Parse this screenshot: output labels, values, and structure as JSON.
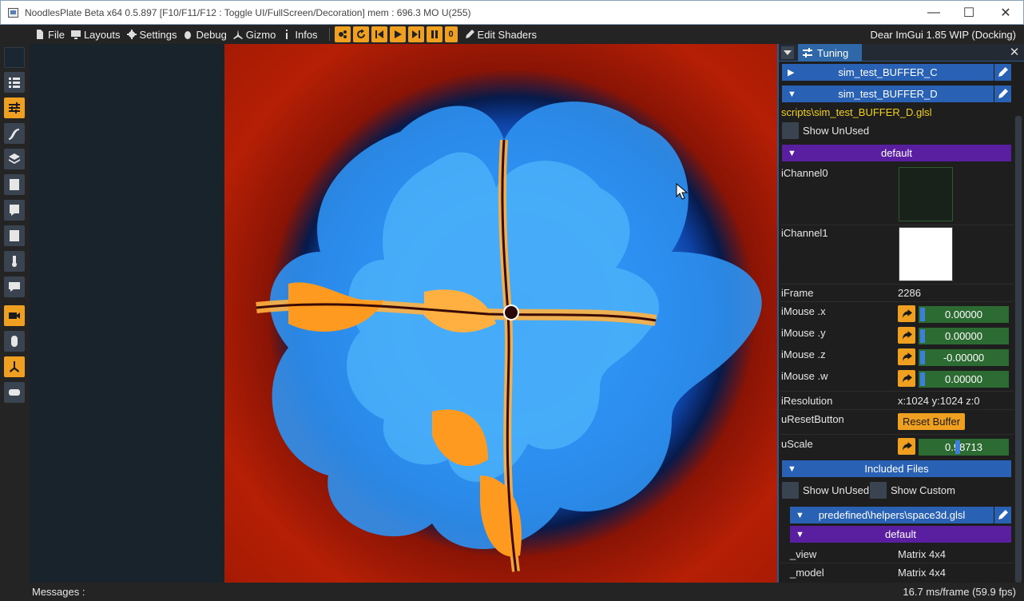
{
  "window": {
    "title": "NoodlesPlate Beta x64 0.5.897 [F10/F11/F12 : Toggle UI/FullScreen/Decoration] mem : 696.3 MO U(255)"
  },
  "menubar": {
    "file": "File",
    "layouts": "Layouts",
    "settings": "Settings",
    "debug": "Debug",
    "gizmo": "Gizmo",
    "infos": "Infos",
    "frame_counter": "0",
    "edit_shaders": "Edit Shaders",
    "imgui_version": "Dear ImGui 1.85 WIP (Docking)"
  },
  "panel": {
    "tab_label": "Tuning",
    "buffer_c": "sim_test_BUFFER_C",
    "buffer_d": "sim_test_BUFFER_D",
    "script_path": "scripts\\sim_test_BUFFER_D.glsl",
    "show_unused": "Show UnUsed",
    "section_default": "default",
    "uniforms": {
      "ichannel0": "iChannel0",
      "ichannel1": "iChannel1",
      "iframe_label": "iFrame",
      "iframe_value": "2286",
      "imouse_x_label": "iMouse .x",
      "imouse_x_value": "0.00000",
      "imouse_y_label": "iMouse .y",
      "imouse_y_value": "0.00000",
      "imouse_z_label": "iMouse .z",
      "imouse_z_value": "-0.00000",
      "imouse_w_label": "iMouse .w",
      "imouse_w_value": "0.00000",
      "iresolution_label": "iResolution",
      "iresolution_value": "x:1024 y:1024 z:0",
      "ureset_label": "uResetButton",
      "ureset_button": "Reset Buffer",
      "uscale_label": "uScale",
      "uscale_value": "0.98713"
    },
    "included_files": "Included Files",
    "show_unused_2": "Show UnUsed",
    "show_custom": "Show Custom",
    "include_path": "predefined\\helpers\\space3d.glsl",
    "include_default": "default",
    "view_label": "_view",
    "view_value": "Matrix 4x4",
    "model_label": "_model",
    "model_value": "Matrix 4x4"
  },
  "status": {
    "messages": "Messages :",
    "fps": "16.7 ms/frame (59.9 fps)"
  },
  "colors": {
    "accent_orange": "#f0a020",
    "header_blue": "#2962b5",
    "header_purple": "#5a1fa0",
    "slider_green": "#2c6b32",
    "path_yellow": "#f2d21a"
  }
}
